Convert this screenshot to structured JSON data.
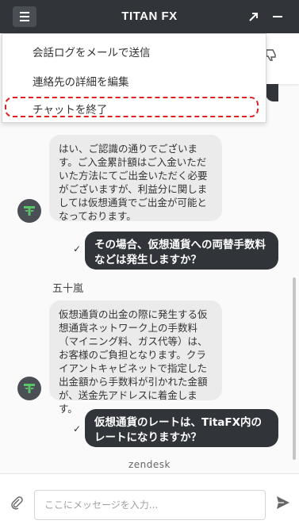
{
  "header": {
    "title": "TITAN FX",
    "menu_icon": "hamburger-icon",
    "popout_icon": "popout-arrow-icon",
    "minimize_icon": "minimize-icon"
  },
  "menu": {
    "items": [
      {
        "label": "会話ログをメールで送信"
      },
      {
        "label": "連絡先の詳細を編集"
      },
      {
        "label": "チャットを終了"
      }
    ]
  },
  "messages": {
    "agent_1": "はい、ご認識の通りでございます。ご入金累計額はご入金いただいた方法にてご出金いただく必要がございますが、利益分に関しましては仮想通貨でご出金が可能となっております。",
    "user_1": "その場合、仮想通貨への両替手数料などは発生しますか？",
    "agent_name": "五十嵐",
    "agent_2": "仮想通貨の出金の際に発生する仮想通貨ネットワーク上の手数料（マイニング料、ガス代等）は、お客様のご負担となります。クライアントキャビネットで指定した出金額から手数料が引かれた金額が、送金先アドレスに着金します。",
    "user_2": "仮想通貨のレートは、TitaFX内のレートになりますか？",
    "check_mark": "✓"
  },
  "branding": {
    "label": "zendesk"
  },
  "composer": {
    "placeholder": "ここにメッセージを入力...",
    "attach_icon": "paperclip-icon",
    "send_icon": "send-icon"
  },
  "colors": {
    "header_bg": "#31353a",
    "user_bubble": "#31353a",
    "agent_bubble": "#ebebeb",
    "highlight": "#e02020"
  }
}
